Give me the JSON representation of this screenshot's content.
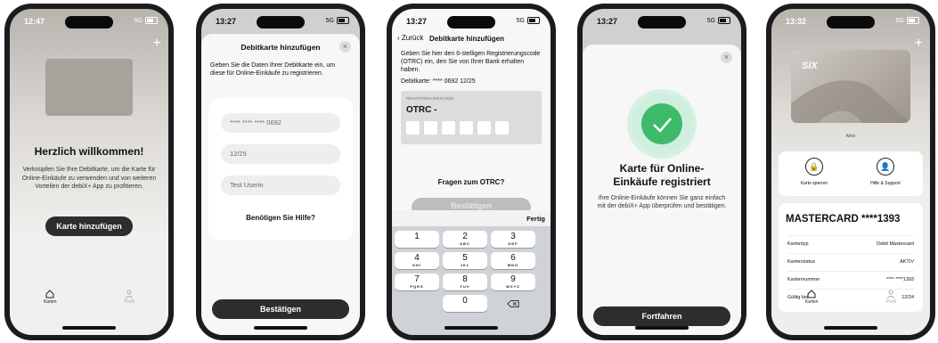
{
  "screens": [
    {
      "time": "12:47",
      "net": "5G",
      "welcome_title": "Herzlich willkommen!",
      "welcome_text": "Verknüpfen Sie Ihre Debitkarte, um die Karte für Online-Einkäufe zu verwenden und von weiteren Vorteilen der debiX+ App zu profitieren.",
      "add_card_button": "Karte hinzufügen",
      "plus_icon": "plus-icon",
      "tabs": [
        {
          "label": "Karten",
          "icon": "house-icon"
        },
        {
          "label": "Profil",
          "icon": "person-icon"
        }
      ]
    },
    {
      "time": "13:27",
      "net": "5G",
      "title": "Debitkarte hinzufügen",
      "intro": "Geben Sie die Daten Ihrer Debitkarte ein, um diese für Online-Einkäufe zu registrieren.",
      "card_number": "**** **** **** 0692",
      "expiry": "12/25",
      "cardholder": "Test Userin",
      "help_link": "Benötigen Sie Hilfe?",
      "confirm_button": "Bestätigen"
    },
    {
      "time": "13:27",
      "net": "5G",
      "back_label": "Zurück",
      "title": "Debitkarte hinzufügen",
      "intro": "Geben Sie hier den 6-stelligen Registrierungscode (OTRC) ein, den Sie von Ihrer Bank erhalten haben.",
      "card_line": "Debitkarte: **** 0692 12/25",
      "code_label": "REGISTRIERUNGSCODE",
      "code_prefix": "OTRC -",
      "otrc_question": "Fragen zum OTRC?",
      "confirm_button": "Bestätigen",
      "done_label": "Fertig",
      "keys": [
        {
          "n": "1",
          "l": ""
        },
        {
          "n": "2",
          "l": "ABC"
        },
        {
          "n": "3",
          "l": "DEF"
        },
        {
          "n": "4",
          "l": "GHI"
        },
        {
          "n": "5",
          "l": "JKL"
        },
        {
          "n": "6",
          "l": "MNO"
        },
        {
          "n": "7",
          "l": "PQRS"
        },
        {
          "n": "8",
          "l": "TUV"
        },
        {
          "n": "9",
          "l": "WXYZ"
        },
        {
          "n": "0",
          "l": ""
        }
      ]
    },
    {
      "time": "13:27",
      "net": "5G",
      "title": "Karte für Online-Einkäufe registriert",
      "text": "Ihre Online-Einkäufe können Sie ganz einfach mit der debiX+ App überprüfen und bestätigen.",
      "continue_button": "Fortfahren"
    },
    {
      "time": "13:32",
      "net": "5G",
      "card_logo": "SIX",
      "card_status_small": "Aktiv",
      "block_card": "Karte sperren",
      "help_support": "Hilfe & Support",
      "card_title": "MASTERCARD ****1393",
      "details": [
        {
          "k": "Kartentyp",
          "v": "Debit Mastercard"
        },
        {
          "k": "Kartenstatus",
          "v": "AKTIV"
        },
        {
          "k": "Kartennummer",
          "v": "**** ****1393"
        },
        {
          "k": "Gültig bis",
          "v": "12/24"
        }
      ],
      "tabs": [
        {
          "label": "Karten",
          "icon": "house-icon"
        },
        {
          "label": "Profil",
          "icon": "person-icon"
        }
      ]
    }
  ],
  "colors": {
    "accent_green": "#3dbb6b",
    "dark_button": "#2d2d2d"
  }
}
